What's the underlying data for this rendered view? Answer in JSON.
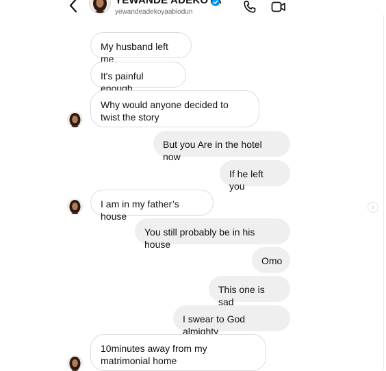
{
  "header": {
    "display_name": "YEWANDE ADEKOYA",
    "username": "yewandeadekoyaabiodun",
    "verified": true,
    "icons": [
      "back-chevron-icon",
      "phone-icon",
      "video-camera-icon",
      "verified-badge-icon"
    ],
    "accent": "#0095f6"
  },
  "messages": [
    {
      "side": "received",
      "text": "My husband left me"
    },
    {
      "side": "received",
      "text": "It's painful enough"
    },
    {
      "side": "received",
      "text": "Why would anyone decided to twist the story"
    },
    {
      "side": "sent",
      "text": "But you Are in the hotel now"
    },
    {
      "side": "sent",
      "text": "If he left you"
    },
    {
      "side": "received",
      "text": "I am in my father’s house"
    },
    {
      "side": "sent",
      "text": "You still probably be in his house"
    },
    {
      "side": "sent",
      "text": "Omo"
    },
    {
      "side": "sent",
      "text": "This one is sad"
    },
    {
      "side": "sent",
      "text": "I swear to God almighty"
    },
    {
      "side": "received",
      "text": "10minutes away from my matrimonial home"
    }
  ],
  "colors": {
    "received_bubble": "#ffffff",
    "received_border": "#dbdbdb",
    "sent_bubble": "#efefef"
  }
}
